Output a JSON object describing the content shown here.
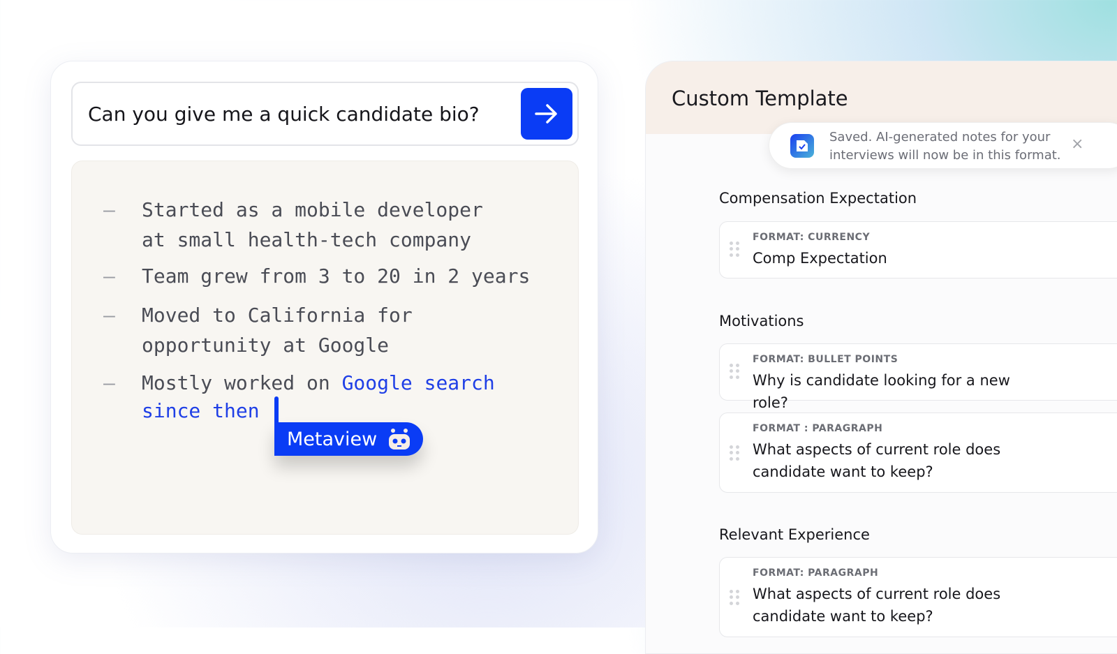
{
  "chat": {
    "question": "Can you give me a quick candidate bio?",
    "send_icon": "arrow-right-icon",
    "bullets": [
      {
        "lines": [
          "Started as a mobile developer",
          "at small health-tech company"
        ]
      },
      {
        "lines": [
          "Team grew from 3 to 20 in 2 years"
        ]
      },
      {
        "lines": [
          "Moved to California for",
          "opportunity at Google"
        ]
      },
      {
        "prefix": "Mostly worked on ",
        "highlight1": "Google search",
        "highlight2": "since then"
      }
    ],
    "dash": "—",
    "cursor_label": "Metaview",
    "accent": "#0a3cf5"
  },
  "template": {
    "title": "Custom Template",
    "toast": {
      "message": "Saved. AI-generated notes for your interviews will now be in this format.",
      "line1": "Saved. AI-generated notes for your",
      "line2": "interviews will now be in this format.",
      "close": "×"
    },
    "sections": [
      {
        "heading": "Compensation Expectation",
        "items": [
          {
            "format": "FORMAT: CURRENCY",
            "label": "Comp Expectation"
          }
        ]
      },
      {
        "heading": "Motivations",
        "items": [
          {
            "format": "FORMAT: BULLET POINTS",
            "label": "Why is candidate looking for a new role?"
          },
          {
            "format": "FORMAT : PARAGRAPH",
            "label": "What aspects of current role does candidate want to keep?"
          }
        ]
      },
      {
        "heading": "Relevant Experience",
        "items": [
          {
            "format": "FORMAT: PARAGRAPH",
            "label": "What aspects of current role does candidate want to keep?"
          }
        ]
      }
    ]
  }
}
